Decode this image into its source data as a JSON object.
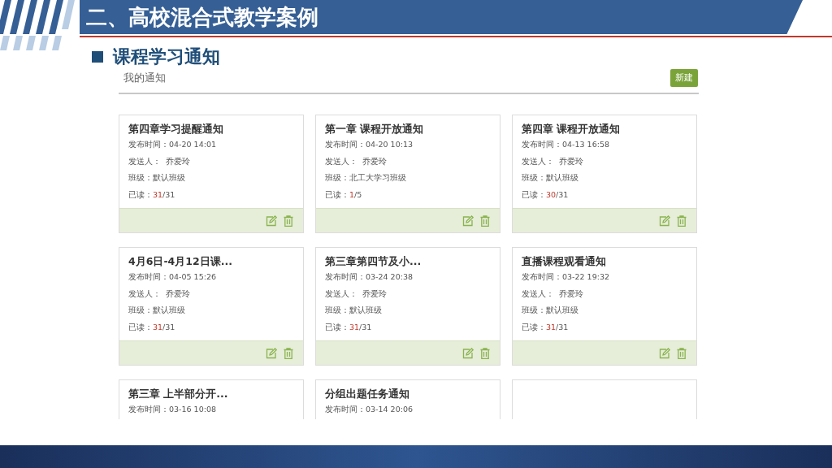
{
  "slide": {
    "title": "二、高校混合式教学案例",
    "subtitle": "课程学习通知"
  },
  "app": {
    "heading": "我的通知",
    "new_button": "新建"
  },
  "notices": [
    {
      "kind": "notice",
      "title": "第四章学习提醒通知",
      "time": "发布时间：04-20 14:01",
      "sender": "发送人：  乔爱玲",
      "class": "班级：默认班级",
      "read_label": "已读：",
      "read": "31",
      "total": "/31"
    },
    {
      "kind": "notice",
      "title": "第一章 课程开放通知",
      "time": "发布时间：04-20 10:13",
      "sender": "发送人：  乔爱玲",
      "class": "班级：北工大学习班级",
      "read_label": "已读：",
      "read": "1",
      "total": "/5"
    },
    {
      "kind": "notice",
      "title": "第四章 课程开放通知",
      "time": "发布时间：04-13 16:58",
      "sender": "发送人：  乔爱玲",
      "class": "班级：默认班级",
      "read_label": "已读：",
      "read": "30",
      "total": "/31"
    },
    {
      "kind": "notice",
      "title": "4月6日-4月12日课...",
      "time": "发布时间：04-05 15:26",
      "sender": "发送人：  乔爱玲",
      "class": "班级：默认班级",
      "read_label": "已读：",
      "read": "31",
      "total": "/31"
    },
    {
      "kind": "notice",
      "title": "第三章第四节及小...",
      "time": "发布时间：03-24 20:38",
      "sender": "发送人：  乔爱玲",
      "class": "班级：默认班级",
      "read_label": "已读：",
      "read": "31",
      "total": "/31"
    },
    {
      "kind": "notice",
      "title": "直播课程观看通知",
      "time": "发布时间：03-22 19:32",
      "sender": "发送人：  乔爱玲",
      "class": "班级：默认班级",
      "read_label": "已读：",
      "read": "31",
      "total": "/31"
    },
    {
      "kind": "notice",
      "title": "第三章 上半部分开...",
      "time": "发布时间：03-16 10:08"
    },
    {
      "kind": "notice",
      "title": "分组出题任务通知",
      "time": "发布时间：03-14 20:06"
    },
    {
      "kind": "blank"
    }
  ]
}
